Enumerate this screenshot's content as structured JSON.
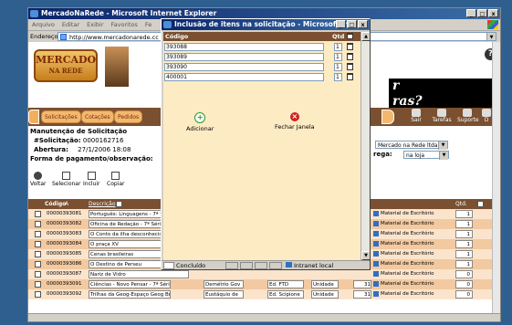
{
  "main_window": {
    "title": "MercadoNaRede - Microsoft Internet Explorer",
    "menu": [
      "Arquivo",
      "Editar",
      "Exibir",
      "Favoritos",
      "Fe"
    ],
    "address_label": "Endereço",
    "address_value": "http://www.mercadonarede.cc",
    "window_buttons": [
      "_",
      "□",
      "x"
    ]
  },
  "header": {
    "logo_line1": "MERCADO",
    "logo_line2": "NA REDE",
    "banner_text1": "r",
    "banner_text2": "ras?"
  },
  "navbar": {
    "tabs": [
      "Solicitações",
      "Cotações",
      "Pedidos"
    ],
    "icons": [
      {
        "label": "Sair",
        "icon": "exit-icon"
      },
      {
        "label": "Tarefas",
        "icon": "tasks-icon"
      },
      {
        "label": "Suporte",
        "icon": "support-icon"
      },
      {
        "label": "D",
        "icon": "more-icon"
      }
    ]
  },
  "form": {
    "section_title": "Manutenção de Solicitação",
    "solicitacao_label": "#Solicitação:",
    "solicitacao_value": "0000162716",
    "abertura_label": "Abertura:",
    "abertura_value": "27/1/2006 18:08",
    "pagamento_label": "Forma de pagamento/observação:",
    "entrega_label": "rega:",
    "fornecedor_value": "Mercado na Rede ltda.",
    "entrega_value": "na loja"
  },
  "toolbar": {
    "buttons": [
      {
        "label": "Voltar",
        "icon": "back-icon"
      },
      {
        "label": "Selecionar",
        "icon": "select-icon"
      },
      {
        "label": "Incluir",
        "icon": "add-doc-icon"
      },
      {
        "label": "Copiar",
        "icon": "copy-icon"
      }
    ]
  },
  "table": {
    "headers": {
      "code": "Código",
      "sort": "A",
      "description": "Descrição",
      "qty": "Qtd."
    },
    "rows": [
      {
        "code": "00000393081",
        "desc": "Português: Linguagens - 7ª Sé",
        "category": "Material de Escritório",
        "qty": "1"
      },
      {
        "code": "00000393082",
        "desc": "Oficina de Redação - 7ª Série",
        "category": "Material de Escritório",
        "qty": "1"
      },
      {
        "code": "00000393083",
        "desc": "O Conto da ilha desconhecida",
        "category": "Material de Escritório",
        "qty": "1"
      },
      {
        "code": "00000393084",
        "desc": "O praça XV",
        "category": "Material de Escritório",
        "qty": "1"
      },
      {
        "code": "00000393085",
        "desc": "Cenas brasileiras",
        "category": "Material de Escritório",
        "qty": "1"
      },
      {
        "code": "00000393086",
        "desc": "O Destino de Perseu",
        "category": "Material de Escritório",
        "qty": "1"
      },
      {
        "code": "00000393087",
        "desc": "Nariz de Vidro",
        "category": "Material de Escritório",
        "qty": "0"
      },
      {
        "code": "00000393091",
        "desc": "Ciências - Novo Pensar - 7ª Série",
        "author": "Demétrio Gov",
        "publisher": "Ed. FTD",
        "unit": "Unidade",
        "num": "31",
        "category": "Material de Escritório",
        "qty": "0"
      },
      {
        "code": "00000393092",
        "desc": "Trilhas da Geog-Espaço Geog Bras e Cida",
        "author": "Eustáquio de",
        "publisher": "Ed. Scipione",
        "unit": "Unidade",
        "num": "31",
        "category": "Material de Escritório",
        "qty": "0"
      }
    ]
  },
  "dialog": {
    "title": "Inclusão de itens na solicitação - Microsoft Inte...",
    "col_code": "Código",
    "col_qty": "Qtd",
    "items": [
      {
        "code": "393088",
        "qty": "1"
      },
      {
        "code": "393089",
        "qty": "1"
      },
      {
        "code": "393090",
        "qty": "1"
      },
      {
        "code": "400001",
        "qty": "1"
      }
    ],
    "add_label": "Adicionar",
    "close_label": "Fechar Janela",
    "status_left": "Concluído",
    "status_right": "Intranet local"
  },
  "colors": {
    "titlebar": "#0a246a",
    "brown_header": "#7a5030",
    "row_alt": "#f2c9a0",
    "row_norm": "#fbe4cc",
    "dialog_body": "#fdebc3",
    "add_icon": "#2a9a2a",
    "close_icon": "#d02020"
  }
}
